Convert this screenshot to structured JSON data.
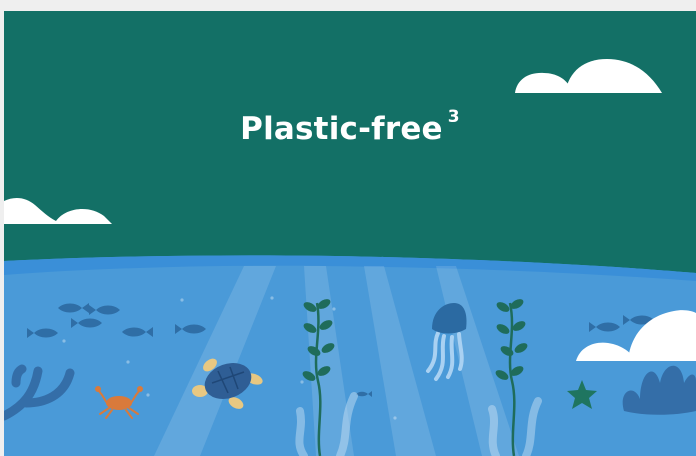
{
  "slide": {
    "title": "Plastic-free",
    "superscript": "3"
  },
  "colors": {
    "sky": "#137066",
    "ocean": "#4a9ad8",
    "wave": "#3a8fd8",
    "cloud": "#ffffff",
    "seaweed": "#1f6c5b",
    "turtle_shell": "#2f5e95",
    "turtle_skin": "#e8c882",
    "crab": "#d97a3b",
    "jellyfish": "#2b6aa2",
    "starfish": "#1f7560",
    "coral": "#346ea8"
  },
  "icons": [
    "cloud-icon",
    "fish-icon",
    "turtle-icon",
    "crab-icon",
    "jellyfish-icon",
    "seaweed-icon",
    "starfish-icon",
    "coral-icon"
  ]
}
